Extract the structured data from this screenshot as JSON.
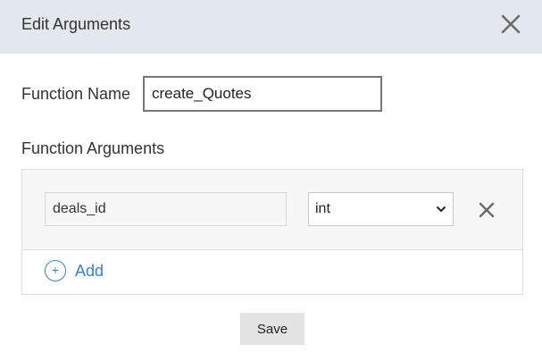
{
  "dialog": {
    "title": "Edit Arguments"
  },
  "function_name": {
    "label": "Function Name",
    "value": "create_Quotes"
  },
  "arguments": {
    "label": "Function Arguments",
    "items": [
      {
        "name": "deals_id",
        "type": "int"
      }
    ],
    "add_label": "Add",
    "add_icon_glyph": "+"
  },
  "footer": {
    "save_label": "Save"
  },
  "icons": {
    "close": "close-icon",
    "remove": "remove-argument-icon",
    "chevron": "chevron-down-icon",
    "add": "plus-circle-icon"
  },
  "colors": {
    "header_bg": "#e3e8ef",
    "accent": "#3c82c4",
    "row_bg": "#f7f7f7",
    "save_bg": "#e3e3e3"
  }
}
